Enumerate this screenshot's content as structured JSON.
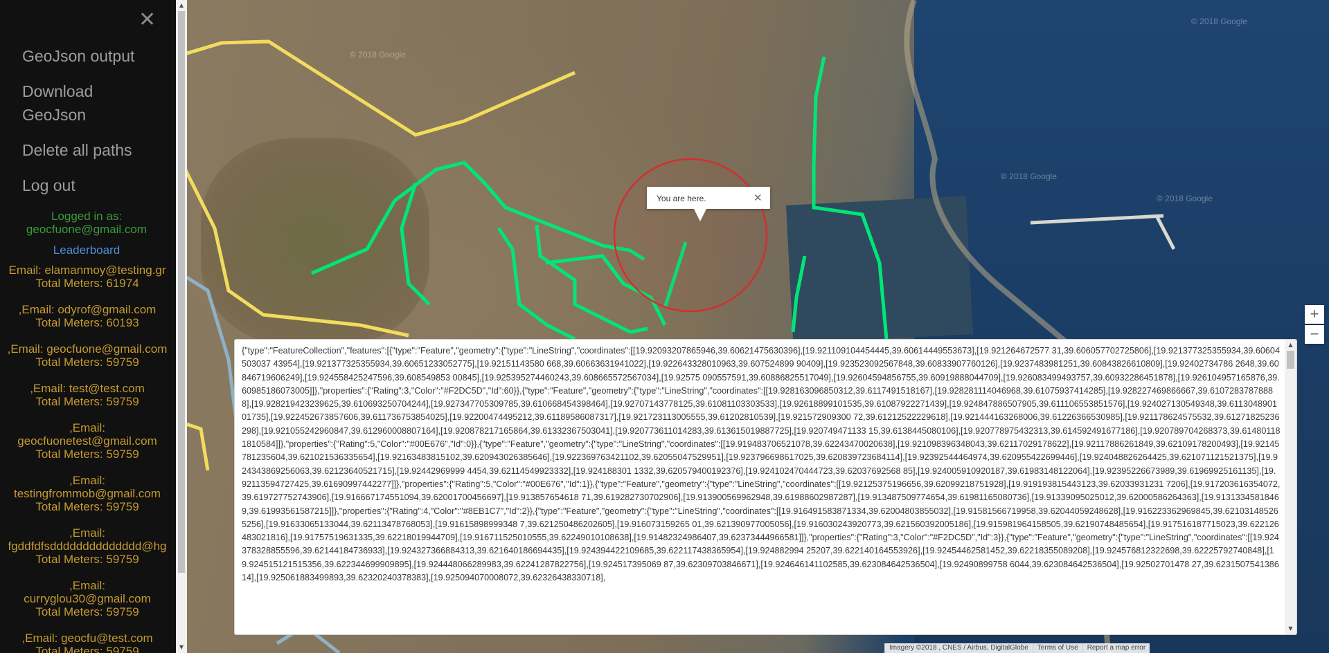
{
  "sidebar": {
    "close_symbol": "✕",
    "menu": {
      "geojson_output": "GeoJson output",
      "download_geojson": "Download GeoJson",
      "delete_all_paths": "Delete all paths",
      "log_out": "Log out"
    },
    "logged_in_label": "Logged in as:",
    "logged_in_email": "geocfuone@gmail.com",
    "leaderboard_link": "Leaderboard",
    "leaderboard": [
      {
        "email_line": "Email: elamanmoy@testing.gr",
        "meters_line": "Total Meters: 61974"
      },
      {
        "email_line": ",Email: odyrof@gmail.com",
        "meters_line": "Total Meters: 60193"
      },
      {
        "email_line": ",Email: geocfuone@gmail.com",
        "meters_line": "Total Meters: 59759"
      },
      {
        "email_line": ",Email: test@test.com",
        "meters_line": "Total Meters: 59759"
      },
      {
        "email_prefix": ",Email:",
        "email_line": "geocfuonetest@gmail.com",
        "meters_line": "Total Meters: 59759"
      },
      {
        "email_prefix": ",Email:",
        "email_line": "testingfrommob@gmail.com",
        "meters_line": "Total Meters: 59759"
      },
      {
        "email_prefix": ",Email:",
        "email_line": "fgddfdfsdddddddddddddd@hg",
        "meters_line": "Total Meters: 59759"
      },
      {
        "email_prefix": ",Email:",
        "email_line": "curryglou30@gmail.com",
        "meters_line": "Total Meters: 59759"
      },
      {
        "email_line": ",Email: geocfu@test.com",
        "meters_line": "Total Meters: 59759"
      }
    ]
  },
  "map": {
    "popup_text": "You are here.",
    "popup_close": "✕",
    "watermark": "© 2018 Google",
    "zoom_in": "+",
    "zoom_out": "−",
    "attribution": [
      "Imagery ©2018 , CNES / Airbus, DigitalGlobe",
      "Terms of Use",
      "Report a map error"
    ],
    "path_colors": {
      "green": "#00E676",
      "yellow": "#F2DC5D",
      "blue": "#8EB1C7"
    },
    "location_circle_color": "#D32F2F"
  },
  "geojson_output": "{\"type\":\"FeatureCollection\",\"features\":[{\"type\":\"Feature\",\"geometry\":{\"type\":\"LineString\",\"coordinates\":[[19.92093207865946,39.60621475630396],[19.921109104454445,39.60614449553673],[19.921264672577 31,39.606057702725806],[19.921377325355934,39.60604503037 43954],[19.921377325355934,39.60651233052775],[19.92151143580 668,39.60663631941022],[19.922643328010963,39.607524899 90409],[19.923523092567848,39.60833907760126],[19.9237483981251,39.60843826610809],[19.92402734786 2648,39.60846719606249],[19.924558425247596,39.608549853 00845],[19.925395274460243,39.608665572567034],[19.92575 090557591,39.60886825517049],[19.92604594856755,39.60919888044709],[19.926083499493757,39.60932286451878],[19.926104957165876,39.60985186073005]]},\"properties\":{\"Rating\":3,\"Color\":\"#F2DC5D\",\"Id\":60}},{\"type\":\"Feature\",\"geometry\":{\"type\":\"LineString\",\"coordinates\":[[19.928163096850312,39.6117491518167],[19.928281114046968,39.61075937414285],[19.928227469866667,39.61072837878888],[19.928219423239625,39.610693250704244],[19.927347705309785,39.610668454398464],[19.92707143778125,39.61081103303533],[19.92618899101535,39.61087922271439],[19.924847886507905,39.611106553851576],[19.924027130549348,39.611304890101735],[19.922452673857606,39.611736753854025],[19.92200474495212,39.61189586087317],[19.921723113005555,39.61202810539],[19.921572909300 72,39.61212522229618],[19.921444163268006,39.61226366530985],[19.921178624575532,39.61271825236298],[19.921055242960847,39.612960008807164],[19.920878217165864,39.61332367503041],[19.920773611014283,39.613615019887725],[19.920749471133 15,39.6138445080106],[19.920778975432313,39.614592491677186],[19.920789704268373,39.614801181810584]]},\"properties\":{\"Rating\":5,\"Color\":\"#00E676\",\"Id\":0}},{\"type\":\"Feature\",\"geometry\":{\"type\":\"LineString\",\"coordinates\":[[19.919483706521078,39.62243470020638],[19.921098396348043,39.62117029178622],[19.92117886261849,39.62109178200493],[19.92145781235604,39.621021536335654],[19.92163483815102,39.620943026385646],[19.922369763421102,39.62055047529951],[19.923796698617025,39.620839723684114],[19.92392544464974,39.620955422699446],[19.924048826264425,39.621071121521375],[19.924343869256063,39.62123640521715],[19.92442969999 4454,39.62114549923332],[19.924188301 1332,39.620579400192376],[19.924102470444723,39.62037692568 85],[19.924005910920187,39.61983148122064],[19.92395226673989,39.61969925161135],[19.92113594727425,39.61690997442277]]},\"properties\":{\"Rating\":5,\"Color\":\"#00E676\",\"Id\":1}},{\"type\":\"Feature\",\"geometry\":{\"type\":\"LineString\",\"coordinates\":[[19.92125375196656,39.62099218751928],[19.919193815443123,39.62033931231 7206],[19.917203616354072,39.619727752743906],[19.916667174551094,39.62001700456697],[19.913857654618 71,39.619282730702906],[19.913900569962948,39.61988602987287],[19.913487509774654,39.61981165080736],[19.91339095025012,39.62000586264363],[19.91313345818469,39.61993561587215]]},\"properties\":{\"Rating\":4,\"Color\":\"#8EB1C7\",\"Id\":2}},{\"type\":\"Feature\",\"geometry\":{\"type\":\"LineString\",\"coordinates\":[[19.916491583871334,39.62004803855032],[19.91581566719958,39.62044059248628],[19.916223362969845,39.621031485265256],[19.91633065133044,39.62113478768053],[19.91615898999348 7,39.621250486202605],[19.916073159265 01,39.621390977005056],[19.916030243920773,39.621560392005186],[19.915981964158505,39.62190748485654],[19.917516187715023,39.622126483021816],[19.91757519631335,39.62218019944709],[19.916711525010555,39.62249010108638],[19.91482324986407,39.62373444966581]]},\"properties\":{\"Rating\":3,\"Color\":\"#F2DC5D\",\"Id\":3}},{\"type\":\"Feature\",\"geometry\":{\"type\":\"LineString\",\"coordinates\":[[19.924378328855596,39.62144184736933],[19.924327366884313,39.621640186694435],[19.924394422109685,39.622117438365954],[19.924882994 25207,39.622140164553926],[19.92454462581452,39.62218355089208],[19.924576812322698,39.62225792740848],[19.924515121515356,39.622344699909895],[19.924448066289983,39.62241287822756],[19.924517395069 87,39.62309703846671],[19.924646141102585,39.623084642536504],[19.92490899758 6044,39.623084642536504],[19.92502701478 27,39.623150754138614],[19.925061883499893,39.62320240378383],[19.925094070008072,39.62326438330718],"
}
